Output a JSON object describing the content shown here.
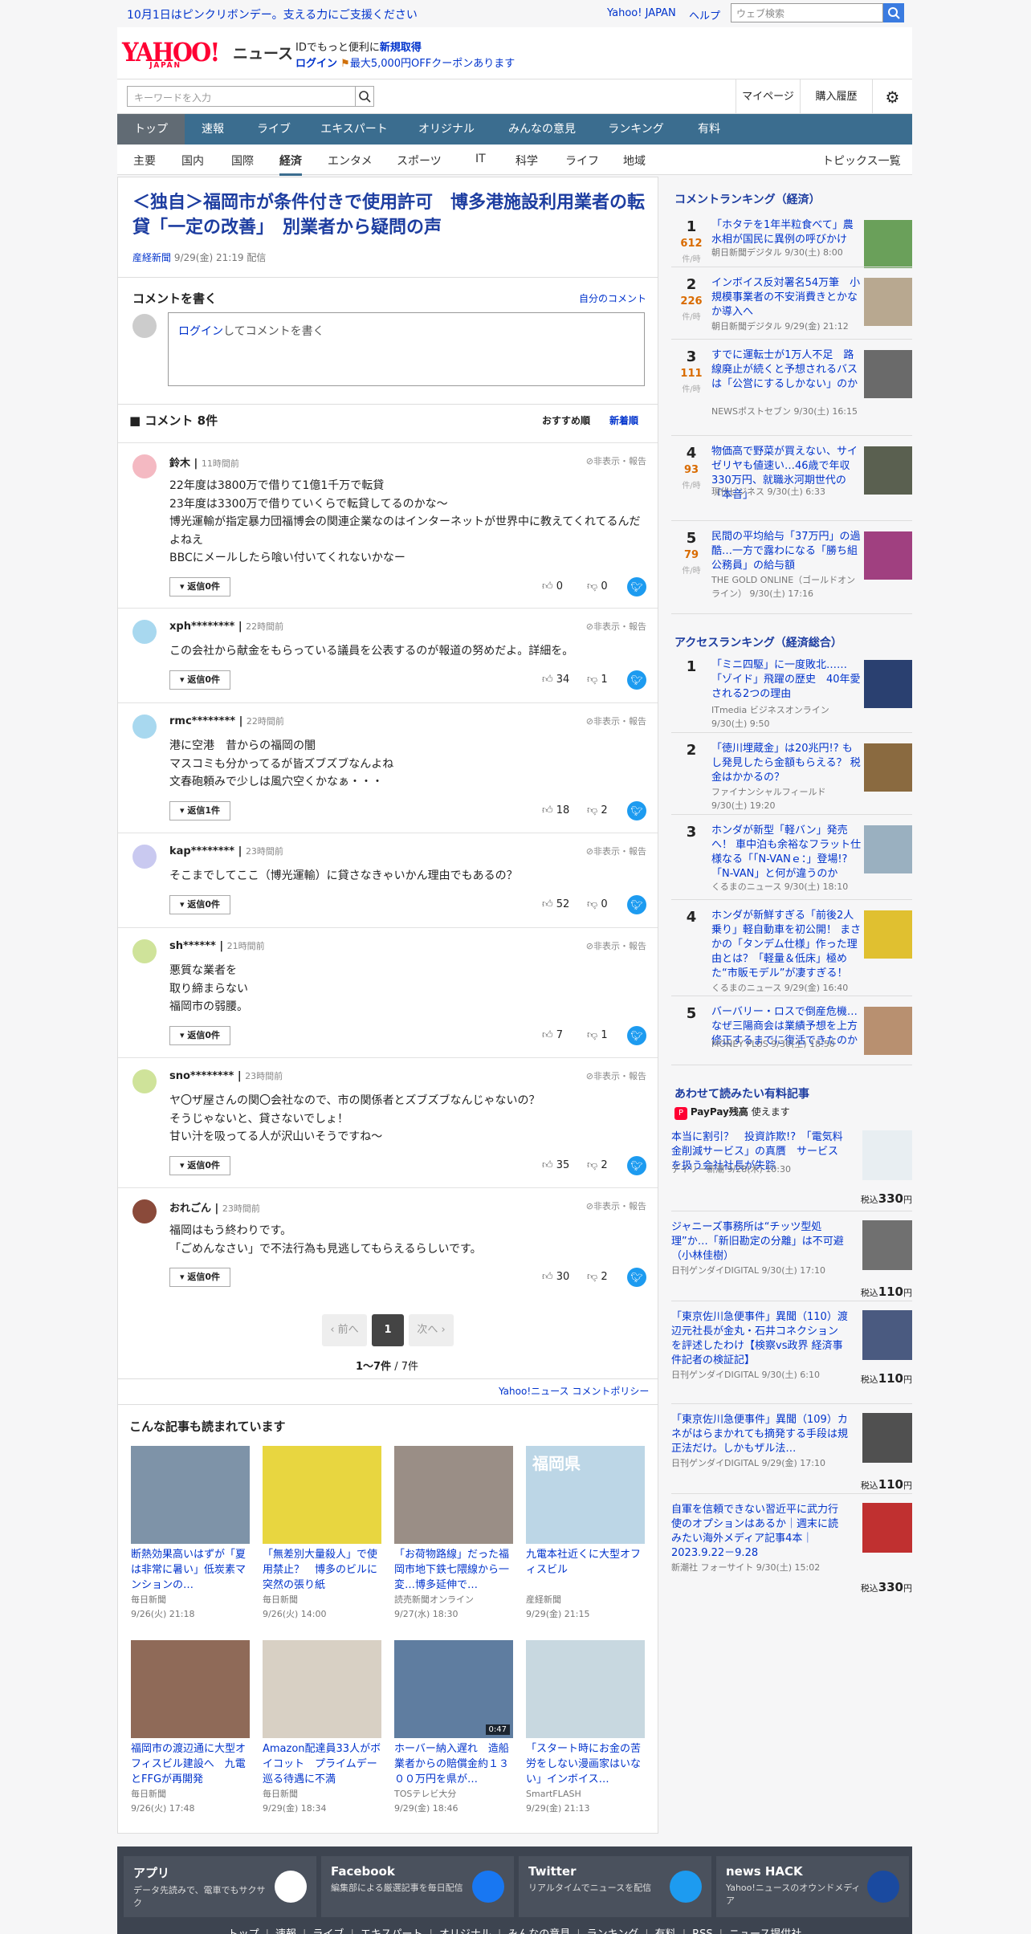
{
  "topbar": {
    "message": "10月1日はピンクリボンデー。支える力にご支援ください",
    "links": [
      "Yahoo! JAPAN",
      "ヘルプ"
    ],
    "search_placeholder": "ウェブ検索"
  },
  "header": {
    "logo": "YAHOO!",
    "logo_sub": "JAPAN",
    "site": "ニュース",
    "line1": "IDでもっと便利に",
    "line1_link": "新規取得",
    "login": "ログイン",
    "coupon": "最大5,000円OFFクーポンあります"
  },
  "search": {
    "placeholder": "キーワードを入力",
    "links": [
      "マイページ",
      "購入履歴"
    ]
  },
  "gnav": [
    "トップ",
    "速報",
    "ライブ",
    "エキスパート",
    "オリジナル",
    "みんなの意見",
    "ランキング",
    "有料"
  ],
  "snav": [
    "主要",
    "国内",
    "国際",
    "経済",
    "エンタメ",
    "スポーツ",
    "IT",
    "科学",
    "ライフ",
    "地域"
  ],
  "snav_right": "トピックス一覧",
  "article": {
    "title": "＜独自＞福岡市が条件付きで使用許可　博多港施設利用業者の転貸「一定の改善」　別業者から疑問の声",
    "source": "産経新聞",
    "date": "9/29(金) 21:19 配信"
  },
  "comment_write": {
    "heading": "コメントを書く",
    "mine": "自分のコメント",
    "login": "ログイン",
    "prompt": "してコメントを書く"
  },
  "comments_head": {
    "title": "コメント 8件",
    "sort1": "おすすめ順",
    "sort2": "新着順"
  },
  "report_label": "非表示・報告",
  "comments": [
    {
      "name": "鈴木",
      "time": "11時間前",
      "text": "22年度は3800万で借りて1億1千万で転貸\n23年度は3300万で借りていくらで転貸してるのかな〜\n博光運輸が指定暴力団福博会の関連企業なのはインターネットが世界中に教えてくれてるんだよねえ\nBBCにメールしたら喰い付いてくれないかなー",
      "reply": "返信0件",
      "up": "0",
      "down": "0",
      "color": "#f4b9c2"
    },
    {
      "name": "xph********",
      "time": "22時間前",
      "text": "この会社から献金をもらっている議員を公表するのが報道の努めだよ。詳細を。",
      "reply": "返信0件",
      "up": "34",
      "down": "1",
      "color": "#a8d8ef"
    },
    {
      "name": "rmc********",
      "time": "22時間前",
      "text": "港に空港　昔からの福岡の闇\nマスコミも分かってるが皆ズブズブなんよね\n文春砲頼みで少しは風穴空くかなぁ・・・",
      "reply": "返信1件",
      "up": "18",
      "down": "2",
      "color": "#a8d8ef"
    },
    {
      "name": "kap********",
      "time": "23時間前",
      "text": "そこまでしてここ（博光運輸）に貸さなきゃいかん理由でもあるの？",
      "reply": "返信0件",
      "up": "52",
      "down": "0",
      "color": "#c9c9f0"
    },
    {
      "name": "sh******",
      "time": "21時間前",
      "text": "悪質な業者を\n取り締まらない\n福岡市の弱腰。",
      "reply": "返信0件",
      "up": "7",
      "down": "1",
      "color": "#cfe39a"
    },
    {
      "name": "sno********",
      "time": "23時間前",
      "text": "ヤ〇ザ屋さんの関〇会社なので、市の関係者とズブズブなんじゃないの？\nそうじゃないと、貸さないでしょ！\n甘い汁を吸ってる人が沢山いそうですね〜",
      "reply": "返信0件",
      "up": "35",
      "down": "2",
      "color": "#cfe39a"
    },
    {
      "name": "おれごん",
      "time": "23時間前",
      "text": "福岡はもう終わりです。\n「ごめんなさい」で不法行為も見逃してもらえるらしいです。",
      "reply": "返信0件",
      "up": "30",
      "down": "2",
      "color": "#8a4a3a"
    }
  ],
  "pager": {
    "prev": "前へ",
    "page": "1",
    "next": "次へ",
    "count": "1〜7件",
    "total": "/ 7件",
    "policy": "Yahoo!ニュース コメントポリシー"
  },
  "recommend": {
    "heading": "こんな記事も読まれています",
    "items": [
      {
        "title": "断熱効果高いはずが「夏は非常に暑い」低炭素マンションの…",
        "src": "毎日新聞",
        "date": "9/26(火) 21:18",
        "bg": "#7e93a8"
      },
      {
        "title": "「無差別大量殺人」で使用禁止？　博多のビルに突然の張り紙",
        "src": "毎日新聞",
        "date": "9/26(火) 14:00",
        "bg": "#e8d640"
      },
      {
        "title": "「お荷物路線」だった福岡市地下鉄七隈線から一変…博多延伸で…",
        "src": "読売新聞オンライン",
        "date": "9/27(水) 18:30",
        "bg": "#9a8e86"
      },
      {
        "title": "九電本社近くに大型オフィスビル",
        "src": "産経新聞",
        "date": "9/29(金) 21:15",
        "bg": "#bcd6e6",
        "label": "福岡県"
      },
      {
        "title": "福岡市の渡辺通に大型オフィスビル建設へ　九電とFFGが再開発",
        "src": "毎日新聞",
        "date": "9/26(火) 17:48",
        "bg": "#8f6a58"
      },
      {
        "title": "Amazon配達員33人がボイコット　プライムデー巡る待遇に不満",
        "src": "毎日新聞",
        "date": "9/29(金) 18:34",
        "bg": "#d8d0c4"
      },
      {
        "title": "ホーバー納入遅れ　造船業者からの賠償金約１３００万円を県が…",
        "src": "TOSテレビ大分",
        "date": "9/29(金) 18:46",
        "bg": "#5f7da0",
        "time": "0:47"
      },
      {
        "title": "「スタート時にお金の苦労をしない漫画家はいない」インボイス…",
        "src": "SmartFLASH",
        "date": "9/29(金) 21:13",
        "bg": "#c8d8e0"
      }
    ]
  },
  "comment_ranking": {
    "heading": "コメントランキング（経済）",
    "unit": "件/時",
    "items": [
      {
        "rank": "1",
        "count": "612",
        "title": "「ホタテを1年半粒食べて」農水相が国民に異例の呼びかけ",
        "src": "朝日新聞デジタル 9/30(土) 8:00",
        "bg": "#6aa05a"
      },
      {
        "rank": "2",
        "count": "226",
        "title": "インボイス反対署名54万筆　小規模事業者の不安消費きとかなか導入へ",
        "src": "朝日新聞デジタル 9/29(金) 21:12",
        "bg": "#b8a890"
      },
      {
        "rank": "3",
        "count": "111",
        "title": "すでに運転士が1万人不足　路線廃止が続くと予想されるバスは「公営にするしかない」のか",
        "src": "NEWSポストセブン 9/30(土) 16:15",
        "bg": "#6a6a6a"
      },
      {
        "rank": "4",
        "count": "93",
        "title": "物価高で野菜が買えない、サイゼリヤも値速い…46歳で年収330万円、就職氷河期世代の「本音」",
        "src": "現代ビジネス 9/30(土) 6:33",
        "bg": "#5a6050"
      },
      {
        "rank": "5",
        "count": "79",
        "title": "民間の平均給与「37万円」の過酷…一方で露わになる「勝ち組公務員」の給与額",
        "src": "THE GOLD ONLINE（ゴールドオンライン） 9/30(土) 17:16",
        "bg": "#a04080"
      }
    ]
  },
  "access_ranking": {
    "heading": "アクセスランキング（経済総合）",
    "items": [
      {
        "rank": "1",
        "title": "「ミニ四駆」に一度敗北……「ゾイド」飛躍の歴史　40年愛される2つの理由",
        "src": "ITmedia ビジネスオンライン 9/30(土) 9:50",
        "bg": "#2a4070"
      },
      {
        "rank": "2",
        "title": "「徳川埋蔵金」は20兆円!? もし発見したら金額もらえる？ 税金はかかるの？",
        "src": "ファイナンシャルフィールド 9/30(土) 19:20",
        "bg": "#8a6a40"
      },
      {
        "rank": "3",
        "title": "ホンダが新型「軽バン」発売へ！ 車中泊も余裕なフラット仕様なる「「N-VANｅ：」登場!? 「N-VAN」と何が違うのか",
        "src": "くるまのニュース 9/30(土) 18:10",
        "bg": "#9ab0c0"
      },
      {
        "rank": "4",
        "title": "ホンダが新鮮すぎる「前後2人乗り」軽自動車を初公開！ まさかの「タンデム仕様」作った理由とは？「軽量＆低床」極めた“市販モデル”が凄すぎる！",
        "src": "くるまのニュース 9/29(金) 16:40",
        "bg": "#e0c030"
      },
      {
        "rank": "5",
        "title": "バーバリー・ロスで倒産危機…なぜ三陽商会は業績予想を上方修正するまでに復活できたのか",
        "src": "MONEY PLUS 9/30(土) 18:50",
        "bg": "#b89070"
      }
    ]
  },
  "paid": {
    "heading": "あわせて読みたい有料記事",
    "paypay": "PayPay残高",
    "paypay_suffix": "使えます",
    "price_prefix": "税込",
    "items": [
      {
        "title": "本当に割引？　投資詐欺!?　「電気料金削減サービス」の真贋　サービスを扱う会社社長が失踪",
        "src": "デイリー新潮 9/28(木) 10:30",
        "price": "330",
        "unit": "円",
        "bg": "#e8eef2"
      },
      {
        "title": "ジャニーズ事務所は“チッツ型処理”か…「新旧勘定の分離」は不可避（小林佳樹）",
        "src": "日刊ゲンダイDIGITAL 9/30(土) 17:10",
        "price": "110",
        "unit": "円",
        "bg": "#707070"
      },
      {
        "title": "「東京佐川急便事件」異聞（110）渡辺元社長が金丸・石井コネクションを評述したわけ【検察vs政界 経済事件記者の検証記】",
        "src": "日刊ゲンダイDIGITAL 9/30(土) 6:10",
        "price": "110",
        "unit": "円",
        "bg": "#4a5a80"
      },
      {
        "title": "「東京佐川急便事件」異聞（109）カネがはらまかれても摘発する手段は規正法だけ。しかもザル法…",
        "src": "日刊ゲンダイDIGITAL 9/29(金) 17:10",
        "price": "110",
        "unit": "円",
        "bg": "#505050"
      },
      {
        "title": "自軍を信頼できない習近平に武力行使のオプションはあるか｜週末に読みたい海外メディア記事4本｜2023.9.22－9.28",
        "src": "新潮社 フォーサイト 9/30(土) 15:02",
        "price": "330",
        "unit": "円",
        "bg": "#c03030"
      }
    ]
  },
  "footer": {
    "boxes": [
      {
        "title": "アプリ",
        "desc": "データ先読みで、電車でもサクサク",
        "color": "#ffffff"
      },
      {
        "title": "Facebook",
        "desc": "編集部による厳選記事を毎日配信",
        "color": "#1877f2"
      },
      {
        "title": "Twitter",
        "desc": "リアルタイムでニュースを配信",
        "color": "#1d9bf0"
      },
      {
        "title": "news HACK",
        "desc": "Yahoo!ニュースのオウンドメディア",
        "color": "#1a4aa0"
      }
    ],
    "nav": [
      "トップ",
      "速報",
      "ライブ",
      "エキスパート",
      "オリジナル",
      "みんなの意見",
      "ランキング",
      "有料",
      "RSS",
      "ニュース提供社"
    ]
  }
}
